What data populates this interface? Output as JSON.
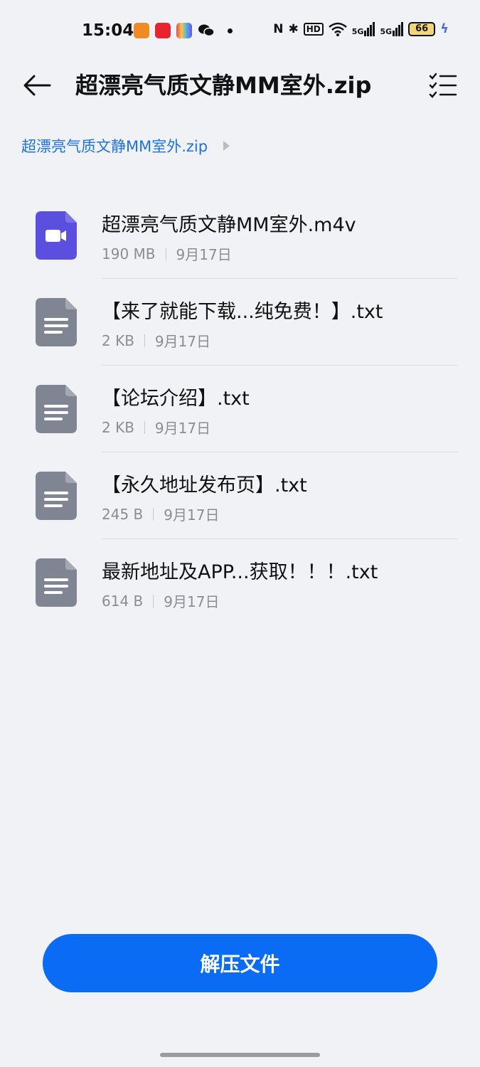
{
  "status_bar": {
    "time": "15:04",
    "nfc": "N",
    "bluetooth": "✱",
    "hd": "HD",
    "signal1": "5G",
    "signal2": "5G",
    "battery": "66",
    "app_colors": [
      "#f08a24",
      "#e8242f",
      "#ffffff",
      "#111111"
    ]
  },
  "app_bar": {
    "title": "超漂亮气质文静MM室外.zip"
  },
  "breadcrumb": {
    "items": [
      "超漂亮气质文静MM室外.zip"
    ]
  },
  "files": [
    {
      "name": "超漂亮气质文静MM室外.m4v",
      "size": "190 MB",
      "date": "9月17日",
      "type": "video",
      "icon": "video-file-icon"
    },
    {
      "name": "【来了就能下载...纯免费！】.txt",
      "size": "2 KB",
      "date": "9月17日",
      "type": "text",
      "icon": "text-file-icon"
    },
    {
      "name": "【论坛介绍】.txt",
      "size": "2 KB",
      "date": "9月17日",
      "type": "text",
      "icon": "text-file-icon"
    },
    {
      "name": "【永久地址发布页】.txt",
      "size": "245 B",
      "date": "9月17日",
      "type": "text",
      "icon": "text-file-icon"
    },
    {
      "name": "最新地址及APP...获取！！！.txt",
      "size": "614 B",
      "date": "9月17日",
      "type": "text",
      "icon": "text-file-icon"
    }
  ],
  "extract_button": {
    "label": "解压文件"
  },
  "colors": {
    "accent": "#0a6cf5",
    "breadcrumb": "#1e72e6",
    "video_icon": "#5b4fe0",
    "text_icon": "#7f8592"
  }
}
